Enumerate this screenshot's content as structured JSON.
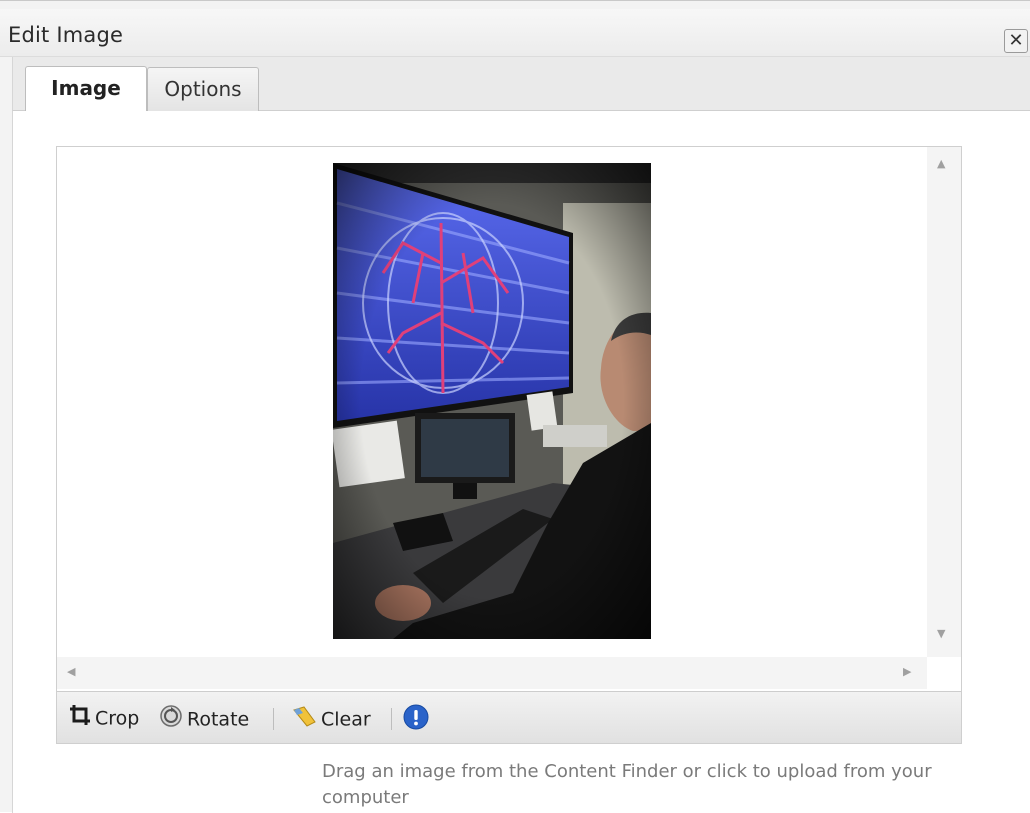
{
  "dialog": {
    "title": "Edit Image",
    "close_label": "✕"
  },
  "tabs": [
    {
      "label": "Image",
      "active": true
    },
    {
      "label": "Options",
      "active": false
    }
  ],
  "editor": {
    "image_alt": "Man at workstation viewing large screen",
    "toolbar": {
      "crop_label": "Crop",
      "rotate_label": "Rotate",
      "clear_label": "Clear"
    },
    "hint": "Drag an image from the Content Finder or click to upload from your computer"
  },
  "colors": {
    "info_icon": "#2a63c9",
    "accent_screen": "#3a4fcf"
  }
}
